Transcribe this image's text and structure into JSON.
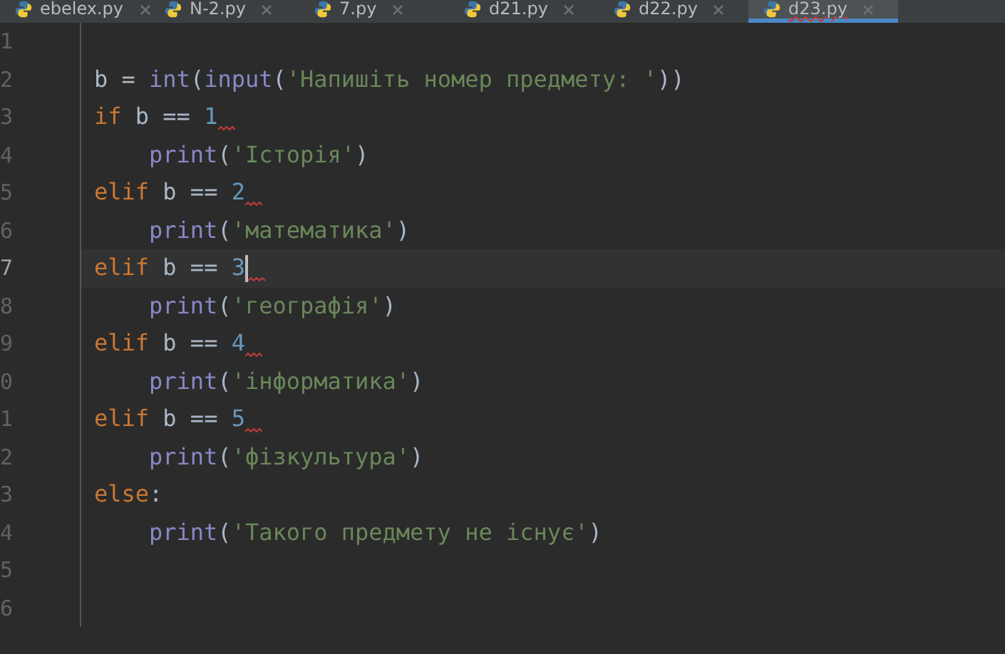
{
  "tabs": [
    {
      "label": "ebelex.py",
      "selected": false
    },
    {
      "label": "N-2.py",
      "selected": false
    },
    {
      "label": "7.py",
      "selected": false
    },
    {
      "label": "d21.py",
      "selected": false
    },
    {
      "label": "d22.py",
      "selected": false
    },
    {
      "label": "d23.py",
      "selected": true
    }
  ],
  "editor": {
    "lines": [
      {
        "number": "1",
        "current": false,
        "warning": false
      },
      {
        "number": "2",
        "current": false,
        "warning": false,
        "indented": false,
        "tokens": [
          {
            "kind": "plain",
            "text": "b = "
          },
          {
            "kind": "builtin",
            "text": "int"
          },
          {
            "kind": "plain",
            "text": "("
          },
          {
            "kind": "builtin",
            "text": "input"
          },
          {
            "kind": "plain",
            "text": "("
          },
          {
            "kind": "string",
            "text": "'Напишіть номер предмету: '"
          },
          {
            "kind": "plain",
            "text": "))"
          }
        ]
      },
      {
        "number": "3",
        "current": false,
        "warning": true,
        "indented": false,
        "tokens": [
          {
            "kind": "keyword",
            "text": "if"
          },
          {
            "kind": "plain",
            "text": " b == "
          },
          {
            "kind": "number",
            "text": "1"
          }
        ]
      },
      {
        "number": "4",
        "current": false,
        "warning": false,
        "indented": true,
        "tokens": [
          {
            "kind": "builtin",
            "text": "print"
          },
          {
            "kind": "plain",
            "text": "("
          },
          {
            "kind": "string",
            "text": "'Історія'"
          },
          {
            "kind": "plain",
            "text": ")"
          }
        ]
      },
      {
        "number": "5",
        "current": false,
        "warning": true,
        "indented": false,
        "tokens": [
          {
            "kind": "keyword",
            "text": "elif"
          },
          {
            "kind": "plain",
            "text": " b == "
          },
          {
            "kind": "number",
            "text": "2"
          }
        ]
      },
      {
        "number": "6",
        "current": false,
        "warning": false,
        "indented": true,
        "tokens": [
          {
            "kind": "builtin",
            "text": "print"
          },
          {
            "kind": "plain",
            "text": "("
          },
          {
            "kind": "string",
            "text": "'математика'"
          },
          {
            "kind": "plain",
            "text": ")"
          }
        ]
      },
      {
        "number": "7",
        "current": true,
        "warning": true,
        "indented": false,
        "tokens": [
          {
            "kind": "keyword",
            "text": "elif"
          },
          {
            "kind": "plain",
            "text": " b == "
          },
          {
            "kind": "number",
            "text": "3"
          }
        ]
      },
      {
        "number": "8",
        "current": false,
        "warning": false,
        "indented": true,
        "tokens": [
          {
            "kind": "builtin",
            "text": "print"
          },
          {
            "kind": "plain",
            "text": "("
          },
          {
            "kind": "string",
            "text": "'географія'"
          },
          {
            "kind": "plain",
            "text": ")"
          }
        ]
      },
      {
        "number": "9",
        "current": false,
        "warning": true,
        "indented": false,
        "tokens": [
          {
            "kind": "keyword",
            "text": "elif"
          },
          {
            "kind": "plain",
            "text": " b == "
          },
          {
            "kind": "number",
            "text": "4"
          }
        ]
      },
      {
        "number": "0",
        "current": false,
        "warning": false,
        "indented": true,
        "tokens": [
          {
            "kind": "builtin",
            "text": "print"
          },
          {
            "kind": "plain",
            "text": "("
          },
          {
            "kind": "string",
            "text": "'інформатика'"
          },
          {
            "kind": "plain",
            "text": ")"
          }
        ]
      },
      {
        "number": "1",
        "current": false,
        "warning": true,
        "indented": false,
        "tokens": [
          {
            "kind": "keyword",
            "text": "elif"
          },
          {
            "kind": "plain",
            "text": " b == "
          },
          {
            "kind": "number",
            "text": "5"
          }
        ]
      },
      {
        "number": "2",
        "current": false,
        "warning": false,
        "indented": true,
        "tokens": [
          {
            "kind": "builtin",
            "text": "print"
          },
          {
            "kind": "plain",
            "text": "("
          },
          {
            "kind": "string",
            "text": "'фізкультура'"
          },
          {
            "kind": "plain",
            "text": ")"
          }
        ]
      },
      {
        "number": "3",
        "current": false,
        "warning": false,
        "indented": false,
        "tokens": [
          {
            "kind": "keyword",
            "text": "else"
          },
          {
            "kind": "plain",
            "text": ":"
          }
        ]
      },
      {
        "number": "4",
        "current": false,
        "warning": false,
        "indented": true,
        "tokens": [
          {
            "kind": "builtin",
            "text": "print"
          },
          {
            "kind": "plain",
            "text": "("
          },
          {
            "kind": "string",
            "text": "'Такого предмету не існує'"
          },
          {
            "kind": "plain",
            "text": ")"
          }
        ]
      },
      {
        "number": "5",
        "current": false,
        "warning": false
      },
      {
        "number": "6",
        "current": false,
        "warning": false
      }
    ]
  }
}
